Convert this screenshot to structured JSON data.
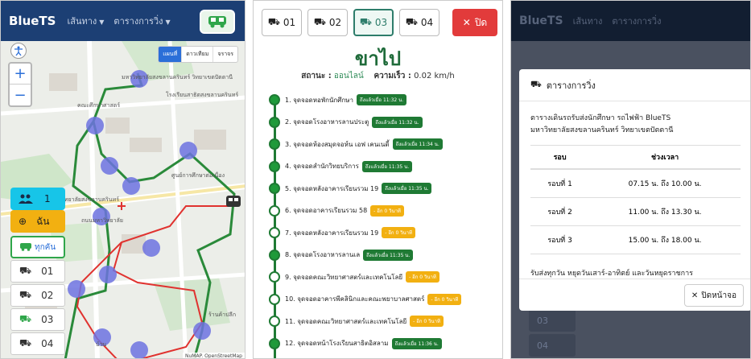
{
  "map_screen": {
    "brand": "BlueTS",
    "nav": {
      "routes": "เส้นทาง",
      "schedule": "ตารางการวิ่ง"
    },
    "map_tabs": [
      "แผนที่",
      "ดาวเทียม",
      "จราจร"
    ],
    "zoom_in": "+",
    "zoom_out": "−",
    "passengers": "1",
    "locate_label": "ฉัน",
    "all_buses_label": "ทุกคัน",
    "routes": [
      "01",
      "02",
      "03",
      "04"
    ],
    "map_labels": [
      "มหาวิทยาลัยสงขลานครินทร์ วิทยาเขตปัตตานี",
      "โรงเรียนสาธิตสงขลานครินทร์",
      "ศูนย์การศึกษาต่อเนื่อง",
      "วิทยาลัยสงขลานครินทร์",
      "ถนนมหาวิทยาลัย",
      "ร้านค้าปลีก",
      "คณะศึกษาศาสตร์",
      "บ้าน"
    ],
    "attribution": "NuMAP. OpenStreetMap"
  },
  "route_screen": {
    "tabs": [
      "01",
      "02",
      "03",
      "04"
    ],
    "active_tab": "03",
    "close_label": "ปิด",
    "direction": "ขาไป",
    "status_label": "สถานะ :",
    "status_value": "ออนไลน์",
    "speed_label": "ความเร็ว :",
    "speed_value": "0.02 km/h",
    "stops": [
      {
        "name": "1. จุดจอดหอพักนักศึกษา",
        "badge": "ถึงแล้วเมื่อ 11:32 น.",
        "state": "done"
      },
      {
        "name": "2. จุดจอดโรงอาหารลานประตู",
        "badge": "ถึงแล้วเมื่อ 11:32 น.",
        "state": "done"
      },
      {
        "name": "3. จุดจอดห้องสมุดจอห์น เอฟ เคนเนดี้",
        "badge": "ถึงแล้วเมื่อ 11:34 น.",
        "state": "done"
      },
      {
        "name": "4. จุดจอดสำนักวิทยบริการ",
        "badge": "ถึงแล้วเมื่อ 11:35 น.",
        "state": "done"
      },
      {
        "name": "5. จุดจอดหลังอาคารเรียนรวม 19",
        "badge": "ถึงแล้วเมื่อ 11:35 น.",
        "state": "done"
      },
      {
        "name": "6. จุดจอดอาคารเรียนรวม 58",
        "badge": "- อีก 0 วินาที",
        "state": "todo"
      },
      {
        "name": "7. จุดจอดหลังอาคารเรียนรวม 19",
        "badge": "- อีก 0 วินาที",
        "state": "todo"
      },
      {
        "name": "8. จุดจอดโรงอาหารลานเล",
        "badge": "ถึงแล้วเมื่อ 11:35 น.",
        "state": "done"
      },
      {
        "name": "9. จุดจอดคณะวิทยาศาสตร์และเทคโนโลยี",
        "badge": "- อีก 0 วินาที",
        "state": "todo"
      },
      {
        "name": "10. จุดจอดอาคารพีคลินิกและคณะพยาบาลศาสตร์",
        "badge": "- อีก 0 วินาที",
        "state": "todo"
      },
      {
        "name": "11. จุดจอดคณะวิทยาศาสตร์และเทคโนโลยี",
        "badge": "- อีก 0 วินาที",
        "state": "todo"
      },
      {
        "name": "12. จุดจอดหน้าโรงเรียนสาธิตอิสลาม",
        "badge": "ถึงแล้วเมื่อ 11:36 น.",
        "state": "done"
      }
    ]
  },
  "schedule_screen": {
    "bg_brand": "BlueTS",
    "bg_nav": {
      "routes": "เส้นทาง",
      "schedule": "ตารางการวิ่ง"
    },
    "bg_routes": [
      "03",
      "04"
    ],
    "modal_title": "ตารางการวิ่ง",
    "description_line1": "ตารางเดินรถรับส่งนักศึกษา รถไฟฟ้า BlueTS",
    "description_line2": "มหาวิทยาลัยสงขลานครินทร์ วิทยาเขตปัตตานี",
    "headers": [
      "รอบ",
      "ช่วงเวลา"
    ],
    "rows": [
      [
        "รอบที่ 1",
        "07.15 น. ถึง 10.00 น."
      ],
      [
        "รอบที่ 2",
        "11.00 น. ถึง 13.30 น."
      ],
      [
        "รอบที่ 3",
        "15.00 น. ถึง 18.00 น."
      ]
    ],
    "note": "รับส่งทุกวัน หยุดวันเสาร์-อาทิตย์ และวันหยุดราชการ",
    "close_label": "ปิดหน้าจอ"
  },
  "colors": {
    "navbar": "#1c3f74",
    "green_route": "#2a8a3a",
    "red_route": "#e0322f",
    "stop_marker": "#6d72e0",
    "close_red": "#e23b3b"
  },
  "icons": {
    "bus": "bus-icon",
    "users": "users-icon",
    "locate": "crosshair-icon",
    "accessibility": "accessibility-icon",
    "close": "close-icon"
  }
}
